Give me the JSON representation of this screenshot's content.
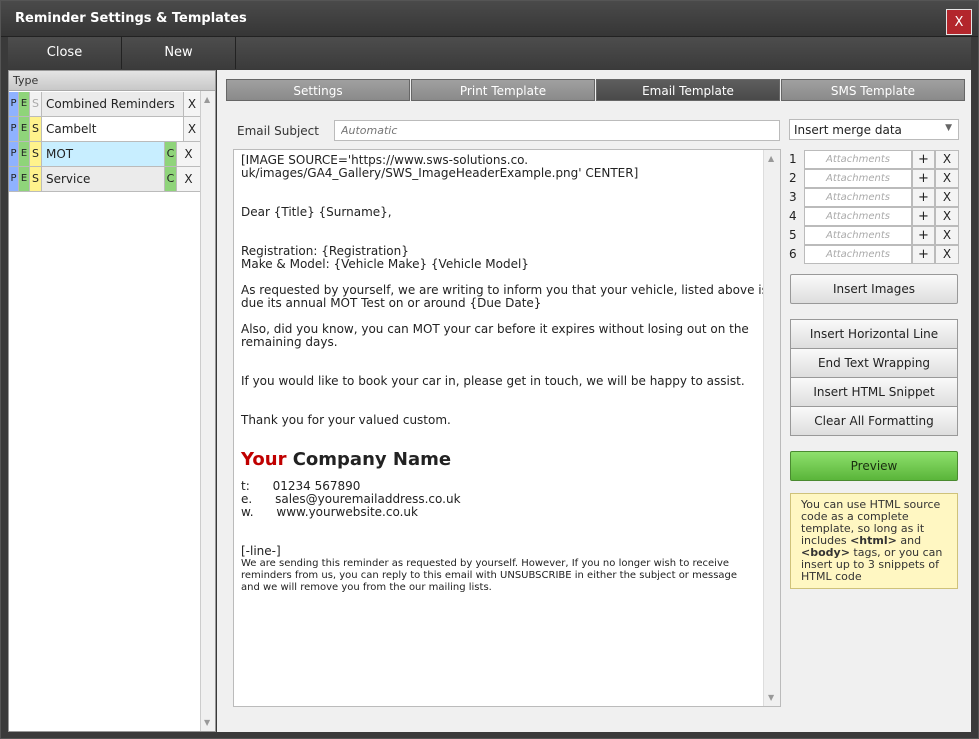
{
  "window": {
    "title": "Reminder Settings & Templates",
    "close_label": "X"
  },
  "toolbar": {
    "close_label": "Close",
    "new_label": "New"
  },
  "type_list": {
    "header": "Type",
    "rows": [
      {
        "p": "P",
        "e": "E",
        "s": "S",
        "name": "Combined Reminders",
        "c": "",
        "x": "X"
      },
      {
        "p": "P",
        "e": "E",
        "s": "S",
        "name": "Cambelt",
        "c": "",
        "x": "X"
      },
      {
        "p": "P",
        "e": "E",
        "s": "S",
        "name": "MOT",
        "c": "C",
        "x": "X"
      },
      {
        "p": "P",
        "e": "E",
        "s": "S",
        "name": "Service",
        "c": "C",
        "x": "X"
      }
    ]
  },
  "tabs": [
    {
      "label": "Settings"
    },
    {
      "label": "Print Template"
    },
    {
      "label": "Email Template"
    },
    {
      "label": "SMS Template"
    }
  ],
  "email": {
    "subject_label": "Email Subject",
    "subject_placeholder": "Automatic",
    "merge_select": "Insert merge data",
    "body": {
      "img1": "[IMAGE SOURCE='https://www.sws-solutions.co.",
      "img2": "uk/images/GA4_Gallery/SWS_ImageHeaderExample.png' CENTER]",
      "dear": "Dear {Title} {Surname},",
      "reg": "Registration: {Registration}",
      "make": "Make & Model: {Vehicle Make} {Vehicle Model}",
      "p1a": "As requested by yourself, we are writing to inform you that your vehicle, listed above is",
      "p1b": "due its annual MOT Test on or around {Due Date}",
      "p2a": "Also, did you know, you can MOT your car before it expires without losing out on the",
      "p2b": "remaining days.",
      "p3": "If you would like to book your car in, please get in touch, we will be happy to assist.",
      "p4": "Thank you for your valued custom.",
      "company_your": "Your",
      "company_rest": " Company Name",
      "tel": "t:      01234 567890",
      "email_line": "e.      sales@youremailaddress.co.uk",
      "web": "w.      www.yourwebsite.co.uk",
      "line": "[-line-]",
      "foot1": "We are sending this reminder as requested by yourself. However, If you no longer wish to receive",
      "foot2": "reminders from us, you can reply to this email with UNSUBSCRIBE in either the subject or message",
      "foot3": "and we will remove you from the our mailing lists."
    }
  },
  "attachments": [
    {
      "num": "1",
      "placeholder": "Attachments",
      "plus": "+",
      "x": "X"
    },
    {
      "num": "2",
      "placeholder": "Attachments",
      "plus": "+",
      "x": "X"
    },
    {
      "num": "3",
      "placeholder": "Attachments",
      "plus": "+",
      "x": "X"
    },
    {
      "num": "4",
      "placeholder": "Attachments",
      "plus": "+",
      "x": "X"
    },
    {
      "num": "5",
      "placeholder": "Attachments",
      "plus": "+",
      "x": "X"
    },
    {
      "num": "6",
      "placeholder": "Attachments",
      "plus": "+",
      "x": "X"
    }
  ],
  "buttons": {
    "insert_images": "Insert Images",
    "insert_hline": "Insert Horizontal Line",
    "end_wrap": "End Text Wrapping",
    "insert_html": "Insert HTML Snippet",
    "clear_format": "Clear All Formatting",
    "preview": "Preview"
  },
  "tip": {
    "t1": "You can use HTML source code as a complete template, so long as it includes ",
    "html_tag": "<html>",
    "t2": " and ",
    "body_tag": "<body>",
    "t3": " tags, or you can insert up to 3 snippets of HTML code"
  },
  "colors": {
    "accent_red": "#b3262c",
    "preview_green": "#5ab53a",
    "company_red": "#c00000",
    "selected_row": "#c8eeff"
  }
}
